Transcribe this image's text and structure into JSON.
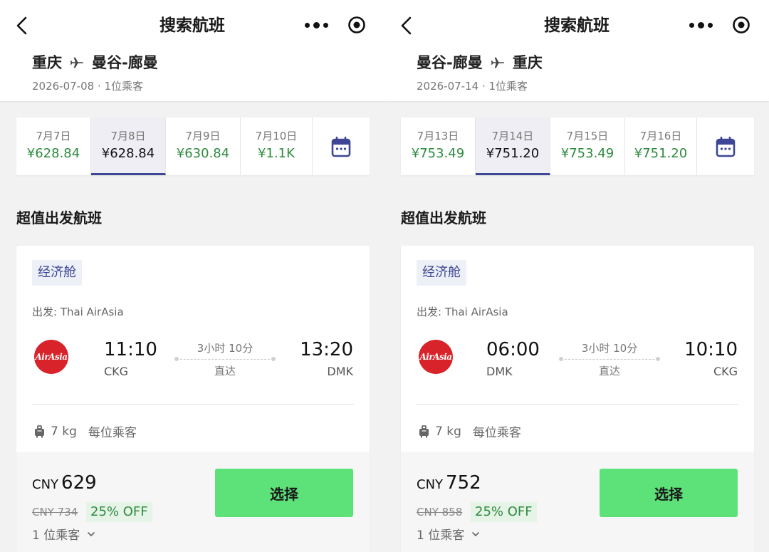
{
  "screens": [
    {
      "nav_title": "搜索航班",
      "route_from": "重庆",
      "route_to": "曼谷-廊曼",
      "route_sub": "2026-07-08 · 1位乘客",
      "dates": [
        {
          "label": "7月7日",
          "price": "¥628.84"
        },
        {
          "label": "7月8日",
          "price": "¥628.84"
        },
        {
          "label": "7月9日",
          "price": "¥630.84"
        },
        {
          "label": "7月10日",
          "price": "¥1.1K"
        }
      ],
      "selected_date_index": 1,
      "section_title": "超值出发航班",
      "flight": {
        "cabin": "经济舱",
        "carrier": "出发: Thai AirAsia",
        "logo_text": "AirAsia",
        "dep_time": "11:10",
        "dep_code": "CKG",
        "arr_time": "13:20",
        "arr_code": "DMK",
        "duration": "3小时 10分",
        "stops": "直达",
        "baggage_weight": "7 kg",
        "baggage_note": "每位乘客",
        "currency": "CNY",
        "price": "629",
        "original_price": "CNY 734",
        "discount": "25% OFF",
        "passengers": "1 位乘客",
        "select_label": "选择"
      }
    },
    {
      "nav_title": "搜索航班",
      "route_from": "曼谷-廊曼",
      "route_to": "重庆",
      "route_sub": "2026-07-14 · 1位乘客",
      "dates": [
        {
          "label": "7月13日",
          "price": "¥753.49"
        },
        {
          "label": "7月14日",
          "price": "¥751.20"
        },
        {
          "label": "7月15日",
          "price": "¥753.49"
        },
        {
          "label": "7月16日",
          "price": "¥751.20"
        }
      ],
      "selected_date_index": 1,
      "section_title": "超值出发航班",
      "flight": {
        "cabin": "经济舱",
        "carrier": "出发: Thai AirAsia",
        "logo_text": "AirAsia",
        "dep_time": "06:00",
        "dep_code": "DMK",
        "arr_time": "10:10",
        "arr_code": "CKG",
        "duration": "3小时 10分",
        "stops": "直达",
        "baggage_weight": "7 kg",
        "baggage_note": "每位乘客",
        "currency": "CNY",
        "price": "752",
        "original_price": "CNY 858",
        "discount": "25% OFF",
        "passengers": "1 位乘客",
        "select_label": "选择"
      }
    }
  ],
  "icons": {
    "back": "chevron-left-icon",
    "more": "more-dots-icon",
    "close": "target-circle-icon",
    "plane": "airplane-icon",
    "calendar": "calendar-icon",
    "baggage": "luggage-icon",
    "expand": "chevron-down-icon"
  },
  "colors": {
    "accent": "#3e4695",
    "price_green": "#2d8a3e",
    "select_button": "#5de27a",
    "airasia_red": "#d8232a"
  }
}
